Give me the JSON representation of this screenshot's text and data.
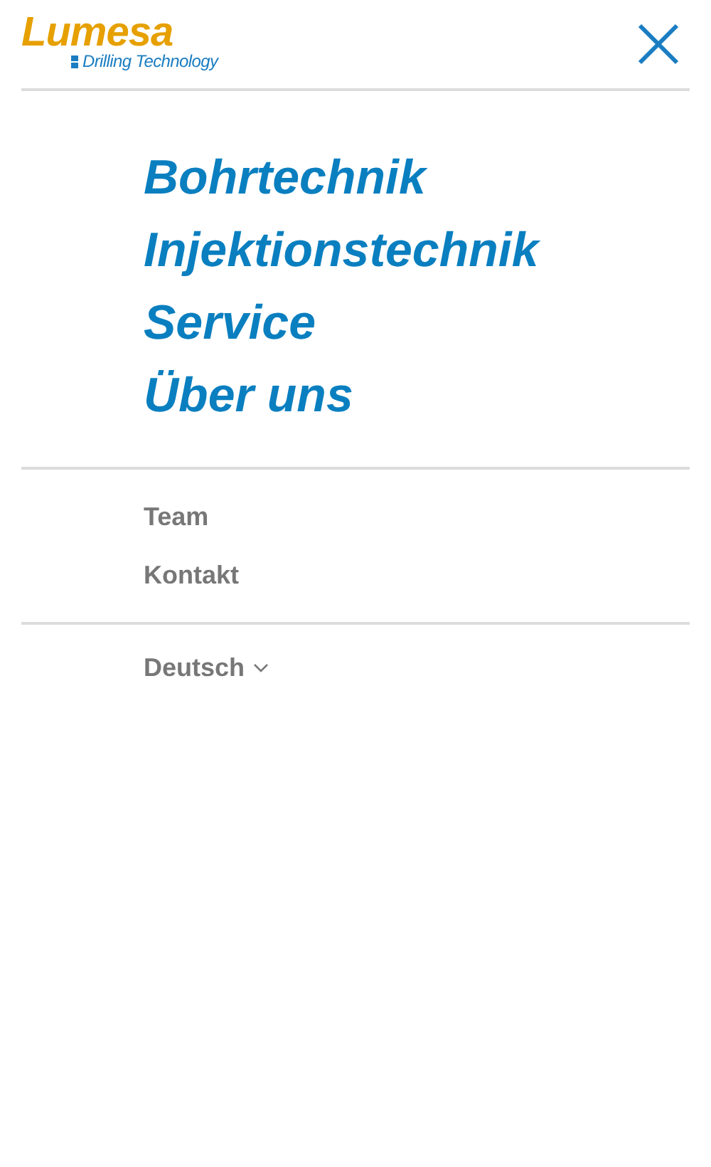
{
  "logo": {
    "name": "Lumesa",
    "tagline": "Drilling Technology"
  },
  "main_nav": [
    "Bohrtechnik",
    "Injektionstechnik",
    "Service",
    "Über uns"
  ],
  "secondary_nav": [
    "Team",
    "Kontakt"
  ],
  "language": {
    "label": "Deutsch"
  }
}
